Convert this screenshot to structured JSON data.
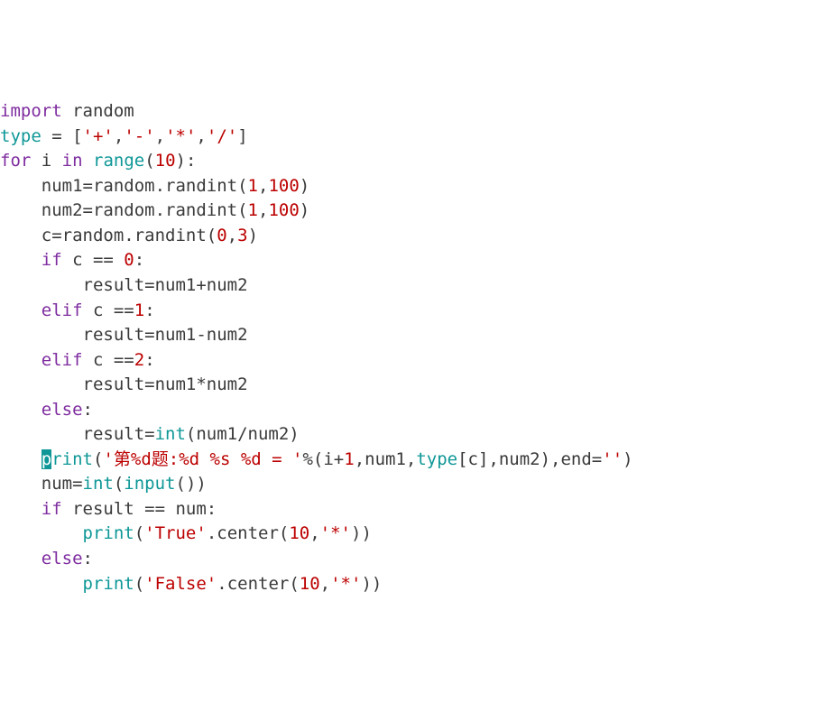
{
  "code": {
    "lines": [
      [
        {
          "t": "import ",
          "c": "kw-import"
        },
        {
          "t": "random",
          "c": "mod"
        }
      ],
      [
        {
          "t": "type",
          "c": "builtin"
        },
        {
          "t": " = [",
          "c": "op"
        },
        {
          "t": "'+'",
          "c": "str"
        },
        {
          "t": ",",
          "c": "op"
        },
        {
          "t": "'-'",
          "c": "str"
        },
        {
          "t": ",",
          "c": "op"
        },
        {
          "t": "'*'",
          "c": "str"
        },
        {
          "t": ",",
          "c": "op"
        },
        {
          "t": "'/'",
          "c": "str"
        },
        {
          "t": "]",
          "c": "op"
        }
      ],
      [
        {
          "t": "for",
          "c": "kw-for"
        },
        {
          "t": " i ",
          "c": "name"
        },
        {
          "t": "in",
          "c": "kw-in"
        },
        {
          "t": " ",
          "c": "name"
        },
        {
          "t": "range",
          "c": "builtin"
        },
        {
          "t": "(",
          "c": "op"
        },
        {
          "t": "10",
          "c": "num"
        },
        {
          "t": "):",
          "c": "op"
        }
      ],
      [
        {
          "t": "    num1=random.randint(",
          "c": "name"
        },
        {
          "t": "1",
          "c": "num"
        },
        {
          "t": ",",
          "c": "op"
        },
        {
          "t": "100",
          "c": "num"
        },
        {
          "t": ")",
          "c": "op"
        }
      ],
      [
        {
          "t": "    num2=random.randint(",
          "c": "name"
        },
        {
          "t": "1",
          "c": "num"
        },
        {
          "t": ",",
          "c": "op"
        },
        {
          "t": "100",
          "c": "num"
        },
        {
          "t": ")",
          "c": "op"
        }
      ],
      [
        {
          "t": "    c=random.randint(",
          "c": "name"
        },
        {
          "t": "0",
          "c": "num"
        },
        {
          "t": ",",
          "c": "op"
        },
        {
          "t": "3",
          "c": "num"
        },
        {
          "t": ")",
          "c": "op"
        }
      ],
      [
        {
          "t": "    ",
          "c": "name"
        },
        {
          "t": "if",
          "c": "kw-if"
        },
        {
          "t": " c == ",
          "c": "name"
        },
        {
          "t": "0",
          "c": "num"
        },
        {
          "t": ":",
          "c": "op"
        }
      ],
      [
        {
          "t": "        result=num1+num2",
          "c": "name"
        }
      ],
      [
        {
          "t": "    ",
          "c": "name"
        },
        {
          "t": "elif",
          "c": "kw-elif"
        },
        {
          "t": " c ==",
          "c": "name"
        },
        {
          "t": "1",
          "c": "num"
        },
        {
          "t": ":",
          "c": "op"
        }
      ],
      [
        {
          "t": "        result=num1-num2",
          "c": "name"
        }
      ],
      [
        {
          "t": "    ",
          "c": "name"
        },
        {
          "t": "elif",
          "c": "kw-elif"
        },
        {
          "t": " c ==",
          "c": "name"
        },
        {
          "t": "2",
          "c": "num"
        },
        {
          "t": ":",
          "c": "op"
        }
      ],
      [
        {
          "t": "        result=num1*num2",
          "c": "name"
        }
      ],
      [
        {
          "t": "    ",
          "c": "name"
        },
        {
          "t": "else",
          "c": "kw-else"
        },
        {
          "t": ":",
          "c": "op"
        }
      ],
      [
        {
          "t": "        result=",
          "c": "name"
        },
        {
          "t": "int",
          "c": "builtin"
        },
        {
          "t": "(num1/num2)",
          "c": "name"
        }
      ],
      [
        {
          "t": "    ",
          "c": "name"
        },
        {
          "t": "p",
          "c": "cursor"
        },
        {
          "t": "rint",
          "c": "builtin"
        },
        {
          "t": "(",
          "c": "op"
        },
        {
          "t": "'第%d题:%d %s %d = '",
          "c": "str"
        },
        {
          "t": "%(i+",
          "c": "name"
        },
        {
          "t": "1",
          "c": "num"
        },
        {
          "t": ",num1,",
          "c": "name"
        },
        {
          "t": "type",
          "c": "builtin"
        },
        {
          "t": "[c],num2),end=",
          "c": "name"
        },
        {
          "t": "''",
          "c": "str"
        },
        {
          "t": ")",
          "c": "op"
        }
      ],
      [
        {
          "t": "    num=",
          "c": "name"
        },
        {
          "t": "int",
          "c": "builtin"
        },
        {
          "t": "(",
          "c": "op"
        },
        {
          "t": "input",
          "c": "builtin"
        },
        {
          "t": "())",
          "c": "op"
        }
      ],
      [
        {
          "t": "    ",
          "c": "name"
        },
        {
          "t": "if",
          "c": "kw-if"
        },
        {
          "t": " result == num:",
          "c": "name"
        }
      ],
      [
        {
          "t": "        ",
          "c": "name"
        },
        {
          "t": "print",
          "c": "builtin"
        },
        {
          "t": "(",
          "c": "op"
        },
        {
          "t": "'True'",
          "c": "str"
        },
        {
          "t": ".center(",
          "c": "name"
        },
        {
          "t": "10",
          "c": "num"
        },
        {
          "t": ",",
          "c": "op"
        },
        {
          "t": "'*'",
          "c": "str"
        },
        {
          "t": "))",
          "c": "op"
        }
      ],
      [
        {
          "t": "    ",
          "c": "name"
        },
        {
          "t": "else",
          "c": "kw-else"
        },
        {
          "t": ":",
          "c": "op"
        }
      ],
      [
        {
          "t": "        ",
          "c": "name"
        },
        {
          "t": "print",
          "c": "builtin"
        },
        {
          "t": "(",
          "c": "op"
        },
        {
          "t": "'False'",
          "c": "str"
        },
        {
          "t": ".center(",
          "c": "name"
        },
        {
          "t": "10",
          "c": "num"
        },
        {
          "t": ",",
          "c": "op"
        },
        {
          "t": "'*'",
          "c": "str"
        },
        {
          "t": "))",
          "c": "op"
        }
      ]
    ]
  }
}
